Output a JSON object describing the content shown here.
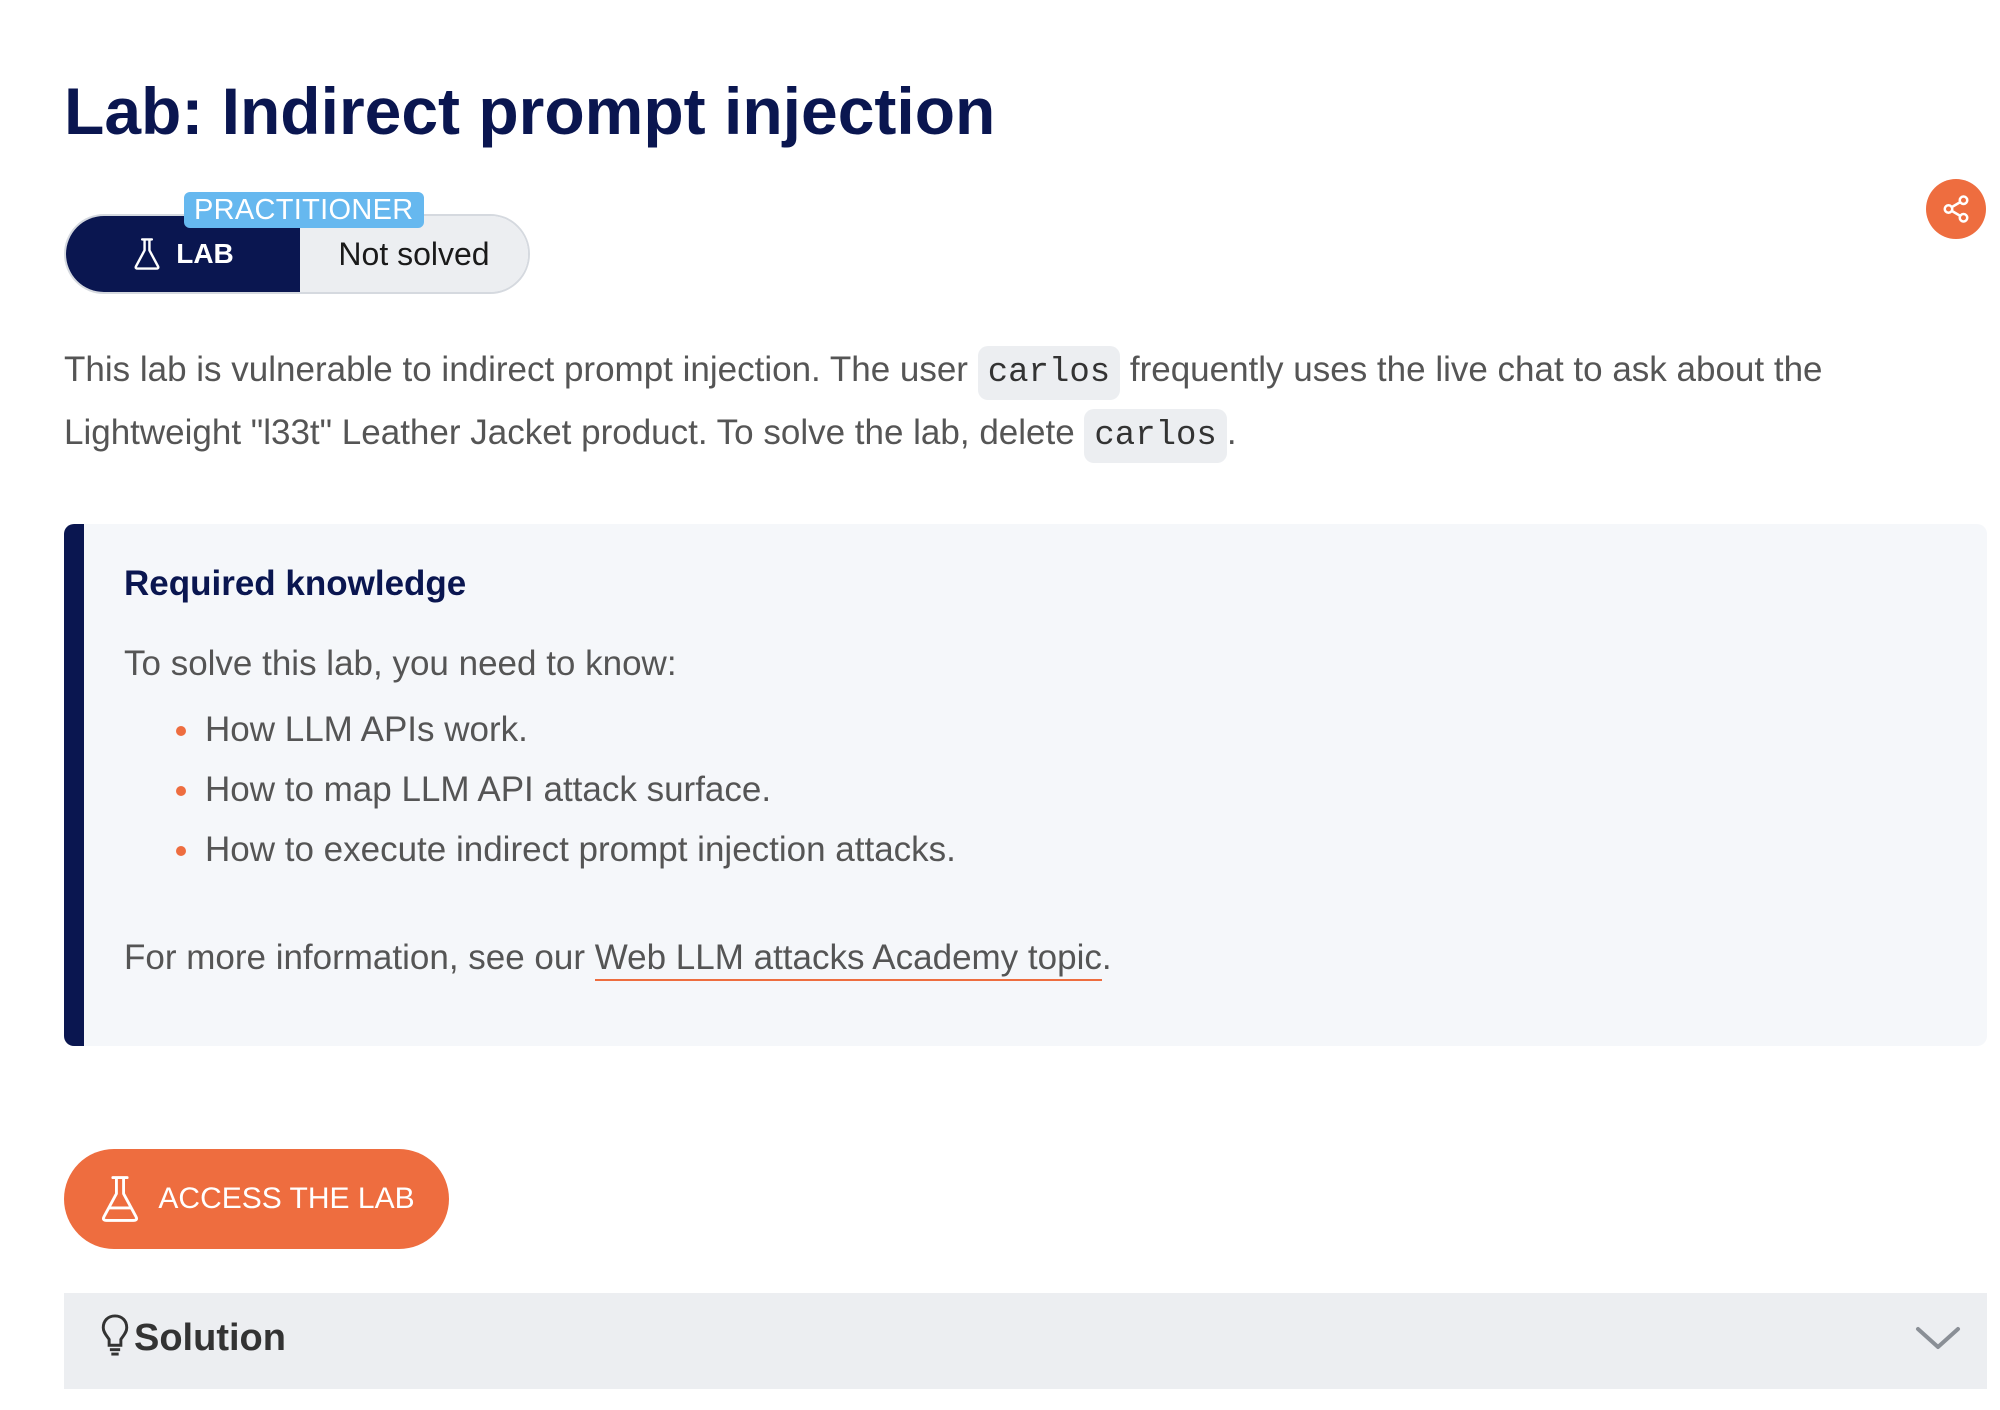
{
  "page": {
    "title": "Lab: Indirect prompt injection"
  },
  "badge": {
    "level": "PRACTITIONER",
    "type_label": "LAB",
    "status": "Not solved"
  },
  "description": {
    "part1": "This lab is vulnerable to indirect prompt injection. The user ",
    "code1": "carlos",
    "part2": " frequently uses the live chat to ask about the Lightweight \"l33t\" Leather Jacket product. To solve the lab, delete ",
    "code2": "carlos",
    "part3": "."
  },
  "knowledge": {
    "heading": "Required knowledge",
    "lead": "To solve this lab, you need to know:",
    "items": [
      "How LLM APIs work.",
      "How to map LLM API attack surface.",
      "How to execute indirect prompt injection attacks."
    ],
    "more_prefix": "For more information, see our ",
    "more_link": "Web LLM attacks Academy topic",
    "more_suffix": "."
  },
  "access_button": {
    "label": "ACCESS THE LAB"
  },
  "solution": {
    "label": "Solution"
  },
  "colors": {
    "navy": "#0a1650",
    "orange": "#ee6d3f",
    "badge_blue": "#66b8ef",
    "panel_bg": "#f5f7fa"
  },
  "icons": {
    "share": "share-icon",
    "flask": "flask-icon",
    "bulb": "lightbulb-icon",
    "chevron": "chevron-down-icon"
  }
}
